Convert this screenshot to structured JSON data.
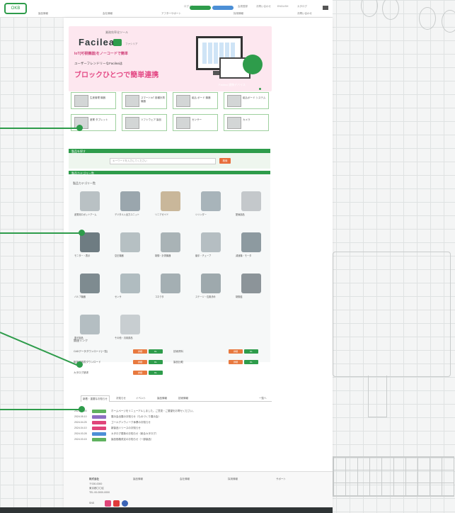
{
  "header": {
    "logo_text": "OKB",
    "mini_links": [
      "ログイン",
      "会員登録",
      "お問い合わせ",
      "ENGLISH",
      "カタログ"
    ],
    "nav": [
      "製品情報",
      "会社情報",
      "アフターサポート",
      "採用情報",
      "お問い合わせ"
    ]
  },
  "hero": {
    "sub": "業務効率化ツール",
    "brand": "Facilea",
    "brand_small": "ファシリア",
    "line1": "IoT(可視機器)をノーコードで簡単",
    "line2": "ユーザーフレンドリーなFacileaは",
    "line3": "ブロックひとつで簡単連携",
    "caption": "Facilea 連携デバイス"
  },
  "categories": [
    {
      "label": "生産管理 機器"
    },
    {
      "label": "スマートIoT 各種計測機器"
    },
    {
      "label": "組込 ボード 機器"
    },
    {
      "label": "組込ボード システム"
    },
    {
      "label": "産業 タブレット"
    },
    {
      "label": "ソフトウェア 製品"
    },
    {
      "label": "センサー"
    },
    {
      "label": "カメラ"
    }
  ],
  "search": {
    "bar_label": "製品を探す",
    "placeholder": "キーワードを入力してください",
    "button": "検索"
  },
  "products_bar": "製品カテゴリ一覧",
  "products_head": "製品カテゴリ一覧",
  "products": [
    {
      "label": "産業用ロボットアーム"
    },
    {
      "label": "デジタル入出力ユニット"
    },
    {
      "label": "リニアガイド"
    },
    {
      "label": "シリンダー"
    },
    {
      "label": "配線部品"
    },
    {
      "label": "モニター・表示"
    },
    {
      "label": "空圧機器"
    },
    {
      "label": "制御・計測機器"
    },
    {
      "label": "継手・チューブ"
    },
    {
      "label": "減速機・モータ"
    },
    {
      "label": "バルブ機器"
    },
    {
      "label": "センサ"
    },
    {
      "label": "コネクタ"
    },
    {
      "label": "ステージ・位置決め"
    },
    {
      "label": "制御盤"
    },
    {
      "label": "電子部品"
    },
    {
      "label": "その他・汎用部品"
    }
  ],
  "related_head": "関連リンク",
  "related": [
    {
      "label": "CADデータダウンロード(一覧)",
      "b1": "詳細",
      "b2": "DL"
    },
    {
      "label": "取扱説明書ダウンロード",
      "b1": "詳細",
      "b2": "DL"
    },
    {
      "label": "カタログ請求",
      "b1": "詳細",
      "b2": "DL"
    },
    {
      "label": "技術資料",
      "b1": "詳細",
      "b2": "DL"
    },
    {
      "label": "製品比較",
      "b1": "詳細",
      "b2": "DL"
    }
  ],
  "tabs": [
    "新着・重要なお知らせ",
    "お知らせ",
    "イベント",
    "製品情報",
    "技術情報"
  ],
  "tabs_more": "一覧へ",
  "news": [
    {
      "date": "2024.05.20",
      "color": "#5fb25f",
      "text": "ホームページをリニューアルしました。ご意見・ご要望をお寄せください。"
    },
    {
      "date": "2024.05.10",
      "color": "#8e6fc3",
      "text": "展示会出展のお知らせ（ものづくり展示会）"
    },
    {
      "date": "2024.04.25",
      "color": "#e0457a",
      "text": "ゴールデンウィーク休業のお知らせ"
    },
    {
      "date": "2024.04.10",
      "color": "#e0457a",
      "text": "新製品リリースのお知らせ"
    },
    {
      "date": "2024.03.28",
      "color": "#4c8fd6",
      "text": "カタログ更新のお知らせ（総合カタログ）"
    },
    {
      "date": "2024.03.15",
      "color": "#5fb25f",
      "text": "製品価格改定のお知らせ（一部製品）"
    }
  ],
  "footer": {
    "company": "株式会社",
    "addr1": "〒000-0000",
    "addr2": "東京都〇〇区",
    "addr3": "TEL 00-0000-0000",
    "links": [
      "製品情報",
      "会社情報",
      "採用情報",
      "サポート"
    ],
    "social_label": "SNS"
  },
  "colors": {
    "accent": "#2e9c4b",
    "pink": "#fde7ef",
    "orange": "#e8793f"
  }
}
